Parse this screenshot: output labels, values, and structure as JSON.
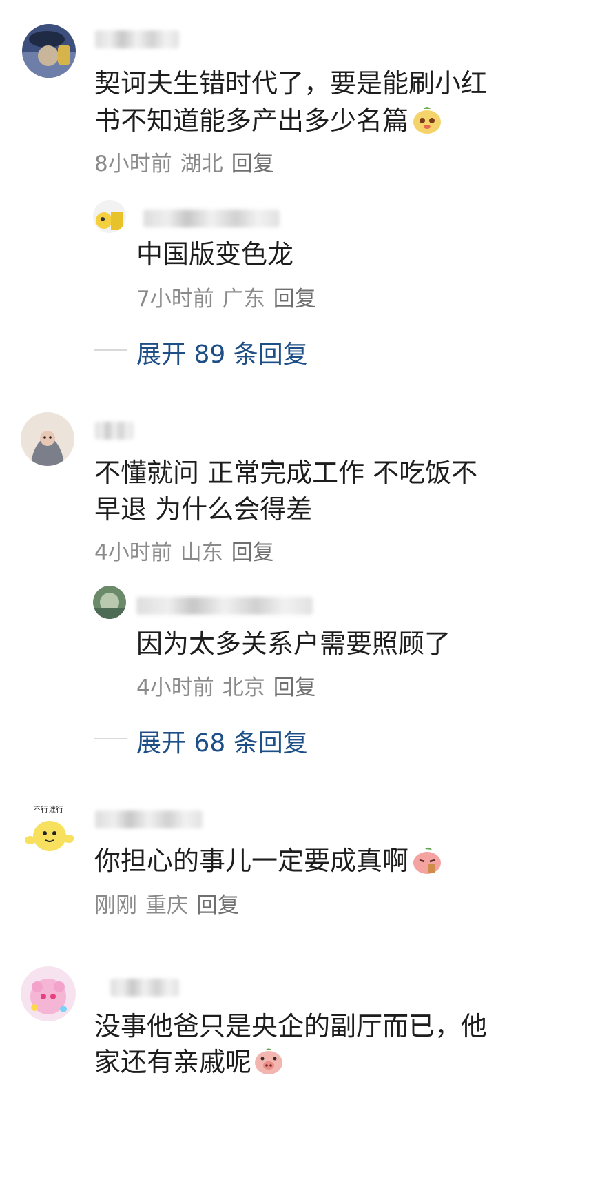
{
  "comments": [
    {
      "text_line1": "契诃夫生错时代了，要是能刷小红",
      "text_line2": "书不知道能多产出多少名篇",
      "time": "8小时前",
      "location": "湖北",
      "reply_label": "回复",
      "sub_reply": {
        "text": "中国版变色龙",
        "time": "7小时前",
        "location": "广东",
        "reply_label": "回复"
      },
      "expand_label": "展开 89 条回复"
    },
    {
      "text_line1": "不懂就问 正常完成工作 不吃饭不",
      "text_line2": "早退 为什么会得差",
      "time": "4小时前",
      "location": "山东",
      "reply_label": "回复",
      "sub_reply": {
        "text": "因为太多关系户需要照顾了",
        "time": "4小时前",
        "location": "北京",
        "reply_label": "回复"
      },
      "expand_label": "展开 68 条回复"
    },
    {
      "text_line1": "你担心的事儿一定要成真啊",
      "time": "刚刚",
      "location": "重庆",
      "reply_label": "回复",
      "avatar_caption": "不行谁行"
    },
    {
      "text_line1": "没事他爸只是央企的副厅而已，他",
      "text_line2": "家还有亲戚呢"
    }
  ],
  "icons": {
    "emoji_1": "peach-face-emoji",
    "emoji_2": "crying-peach-emoji",
    "emoji_3": "pig-face-emoji"
  },
  "colors": {
    "expand_link": "#1d4f86",
    "meta_text": "#8a8a8a"
  }
}
